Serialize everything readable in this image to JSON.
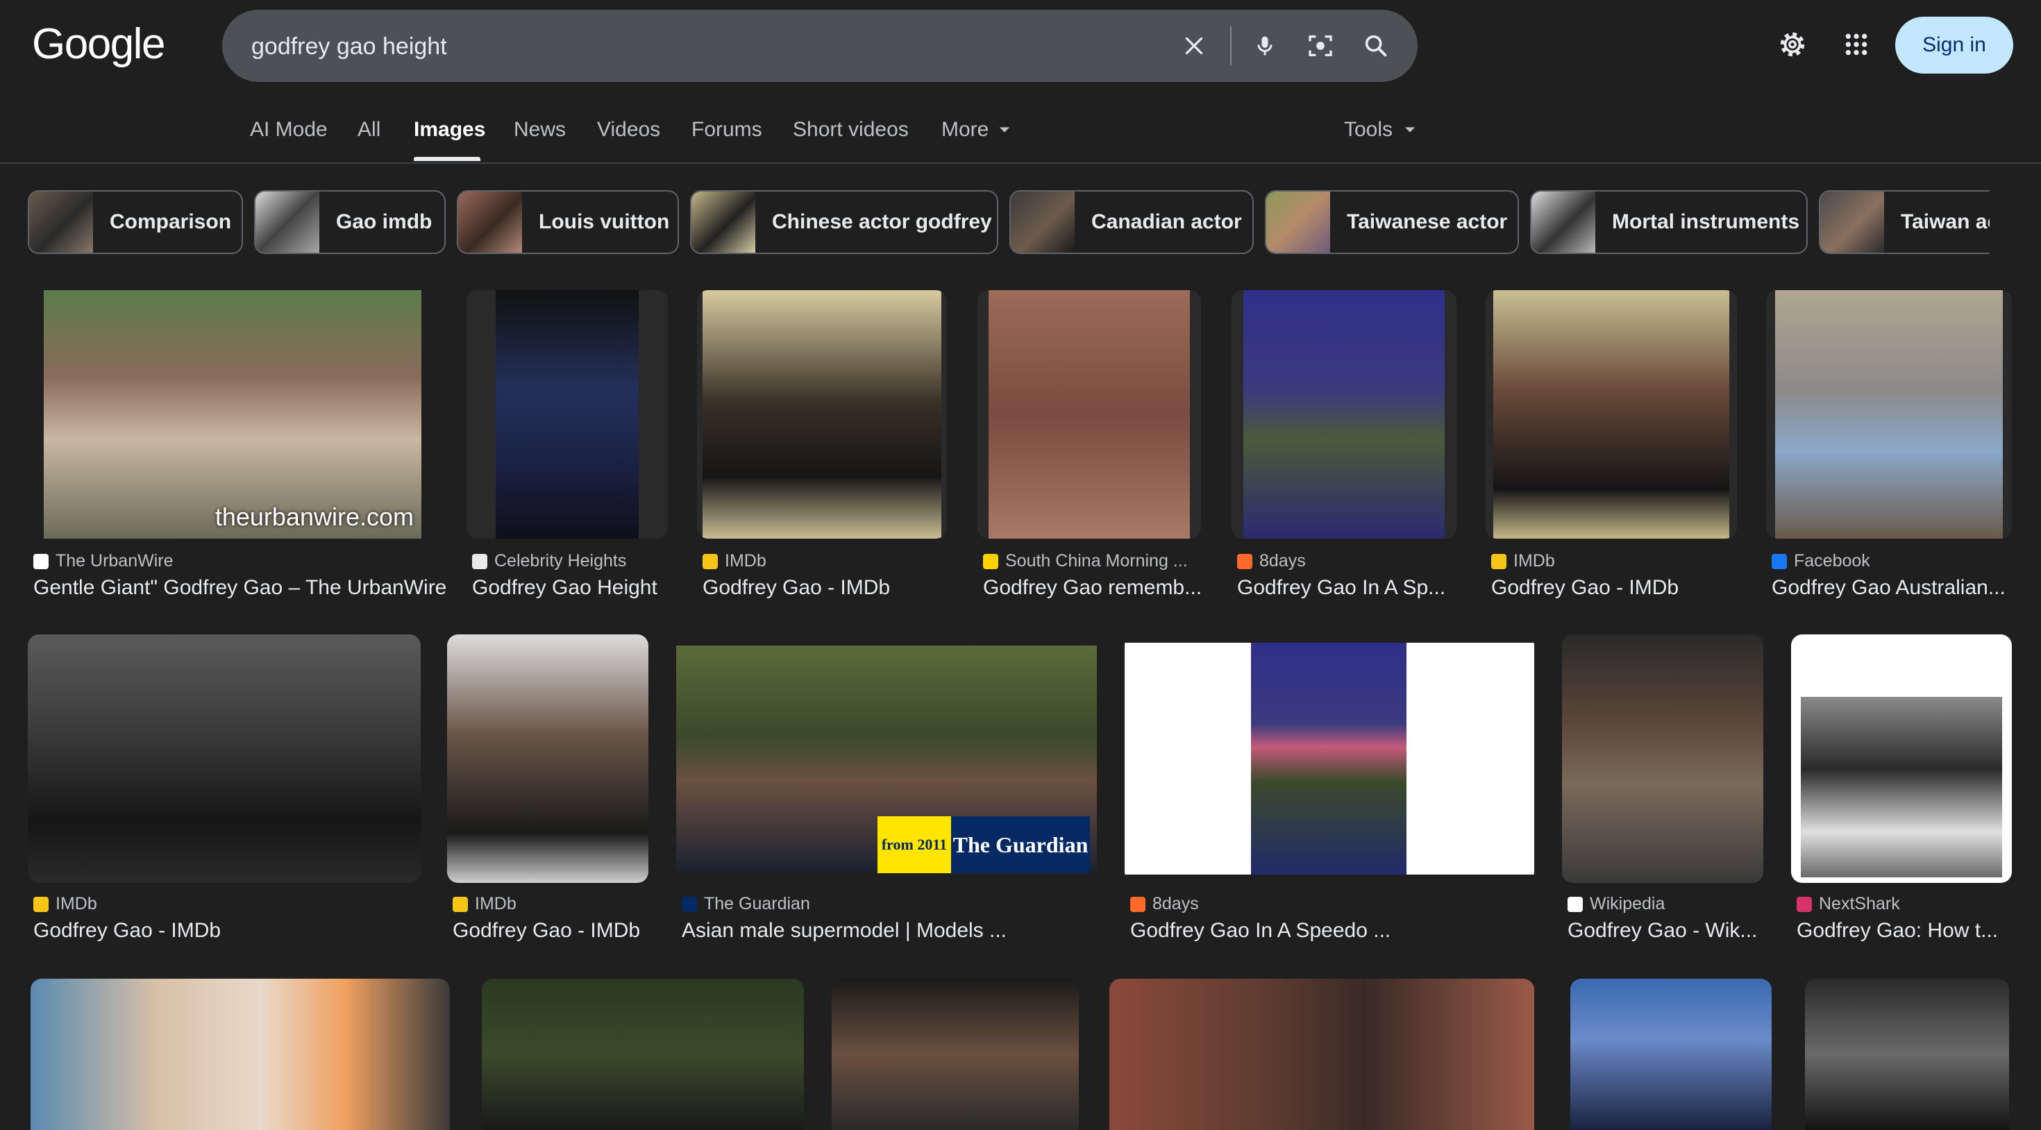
{
  "logo": "Google",
  "search": {
    "query": "godfrey gao height"
  },
  "header": {
    "sign_in": "Sign in"
  },
  "tabs": [
    "AI Mode",
    "All",
    "Images",
    "News",
    "Videos",
    "Forums",
    "Short videos",
    "More"
  ],
  "active_tab": "Images",
  "tools_label": "Tools",
  "chips": [
    "Comparison",
    "Gao imdb",
    "Louis vuitton",
    "Chinese actor godfrey",
    "Canadian actor",
    "Taiwanese actor",
    "Mortal instruments",
    "Taiwan ac"
  ],
  "results": [
    {
      "source": "The UrbanWire",
      "title": "Gentle Giant\" Godfrey Gao – The UrbanWire",
      "watermark": "theurbanwire.com"
    },
    {
      "source": "Celebrity Heights",
      "title": "Godfrey Gao Height"
    },
    {
      "source": "IMDb",
      "title": "Godfrey Gao - IMDb"
    },
    {
      "source": "South China Morning ...",
      "title": "Godfrey Gao rememb..."
    },
    {
      "source": "8days",
      "title": "Godfrey Gao In A Sp..."
    },
    {
      "source": "IMDb",
      "title": "Godfrey Gao - IMDb"
    },
    {
      "source": "Facebook",
      "title": "Godfrey Gao Australian..."
    },
    {
      "source": "IMDb",
      "title": "Godfrey Gao - IMDb"
    },
    {
      "source": "IMDb",
      "title": "Godfrey Gao - IMDb"
    },
    {
      "source": "The Guardian",
      "title": "Asian male supermodel | Models ...",
      "badge_year": "from 2011",
      "badge_name": "The Guardian"
    },
    {
      "source": "8days",
      "title": "Godfrey Gao In A Speedo ..."
    },
    {
      "source": "Wikipedia",
      "title": "Godfrey Gao - Wik..."
    },
    {
      "source": "NextShark",
      "title": "Godfrey Gao: How t..."
    }
  ],
  "colors": {
    "background": "#1f1f1f",
    "search_bg": "#4d5156",
    "sign_in_bg": "#c2e7ff",
    "text_primary": "#e8eaed",
    "text_secondary": "#bdc1c6"
  }
}
